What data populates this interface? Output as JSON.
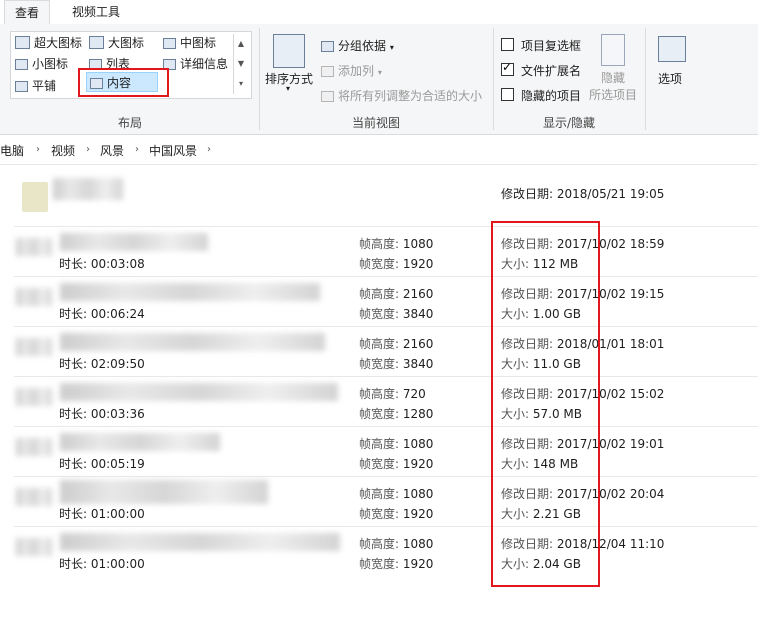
{
  "tabs": [
    "查看",
    "视频工具"
  ],
  "ribbon": {
    "layout": {
      "items": [
        "超大图标",
        "大图标",
        "中图标",
        "小图标",
        "列表",
        "详细信息",
        "平铺",
        "内容"
      ],
      "selected": "内容",
      "label": "布局"
    },
    "current_view": {
      "sort_by": "排序方式",
      "group_by": "分组依据",
      "add_column": "添加列",
      "fit_columns": "将所有列调整为合适的大小",
      "label": "当前视图"
    },
    "show_hide": {
      "item_checkboxes": "项目复选框",
      "file_extensions": "文件扩展名",
      "hidden_items": "隐藏的项目",
      "hide_selected_line1": "隐藏",
      "hide_selected_line2": "所选项目",
      "label": "显示/隐藏",
      "item_checkboxes_checked": false,
      "file_extensions_checked": true,
      "hidden_items_checked": false
    },
    "options": "选项"
  },
  "breadcrumb": [
    "电脑",
    "视频",
    "风景",
    "中国风景"
  ],
  "folder": {
    "date": "修改日期: 2018/05/21 19:05"
  },
  "files": [
    {
      "duration": "时长: 00:03:08",
      "height": "1080",
      "width": "1920",
      "date": "2017/10/02 18:59",
      "size": "112 MB"
    },
    {
      "duration": "时长: 00:06:24",
      "height": "2160",
      "width": "3840",
      "date": "2017/10/02 19:15",
      "size": "1.00 GB"
    },
    {
      "duration": "时长: 02:09:50",
      "height": "2160",
      "width": "3840",
      "date": "2018/01/01 18:01",
      "size": "11.0 GB"
    },
    {
      "duration": "时长: 00:03:36",
      "height": "720",
      "width": "1280",
      "date": "2017/10/02 15:02",
      "size": "57.0 MB"
    },
    {
      "duration": "时长: 00:05:19",
      "height": "1080",
      "width": "1920",
      "date": "2017/10/02 19:01",
      "size": "148 MB"
    },
    {
      "duration": "时长: 01:00:00",
      "height": "1080",
      "width": "1920",
      "date": "2017/10/02 20:04",
      "size": "2.21 GB"
    },
    {
      "duration": "时长: 01:00:00",
      "height": "1080",
      "width": "1920",
      "date": "2018/12/04 11:10",
      "size": "2.04 GB"
    }
  ],
  "labels": {
    "height": "帧高度:",
    "width": "帧宽度:",
    "date": "修改日期:",
    "size": "大小:"
  },
  "colors": {
    "highlight": "#e0181c",
    "selected_bg": "#cce8ff"
  }
}
